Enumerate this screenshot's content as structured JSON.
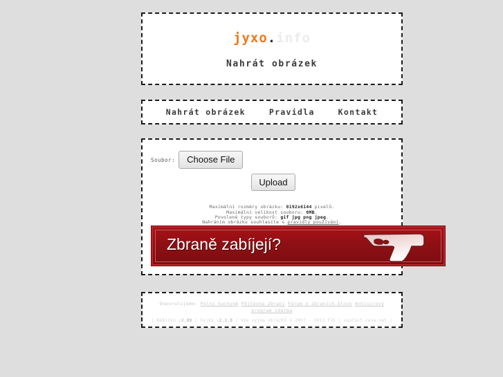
{
  "site": {
    "logo_brand": "jyxo",
    "logo_dot": ".",
    "logo_tld": "info",
    "page_title": "Nahrát obrázek",
    "brand_color": "#f07818"
  },
  "nav": {
    "items": [
      {
        "label": "Nahrát obrázek"
      },
      {
        "label": "Pravidla"
      },
      {
        "label": "Kontakt"
      }
    ]
  },
  "form": {
    "file_label": "Soubor:",
    "choose_file_label": "Choose File",
    "upload_label": "Upload"
  },
  "info": {
    "line1_prefix": "Maximální rozměry obrázku: ",
    "line1_value": "8192x6144",
    "line1_suffix": " pixelů.",
    "line2_prefix": "Maximální velikost souboru: ",
    "line2_value": "8MB",
    "line2_suffix": ".",
    "line3_prefix": "Povolené typy souborů: ",
    "line3_value": "gif jpg png jpeg",
    "line3_suffix": ".",
    "line4_prefix": "Nahráním obrázku souhlasíte s ",
    "line4_link": "pravidly používání",
    "line4_suffix": "."
  },
  "banner": {
    "text": "Zbraně zabíjejí?",
    "bg_color": "#8e1014",
    "border_color": "#b9272b",
    "icon": "handgun-icon"
  },
  "footer": {
    "recommend_label": "Doporučujeme:",
    "links": [
      "Polní kuchyně",
      "Půjčovna zbraní",
      "Fórum o zbraních Glock",
      "Antivirový program zdarma"
    ],
    "meta_parts": [
      "| Nebíčko v",
      "2.00",
      " | Fejká v",
      "2.1.0",
      " | Vše vyjma obrázků © 2007 - 2011 FIK | součást cesa.net |"
    ],
    "meta_v1": "2.00",
    "meta_v2": "2.1.0",
    "meta_a": "| Nebíčko v",
    "meta_b": " | Fejká v",
    "meta_c": " | Vše vyjma obrázků © 2007 - 2011 FIK | součást cesa.net |"
  }
}
